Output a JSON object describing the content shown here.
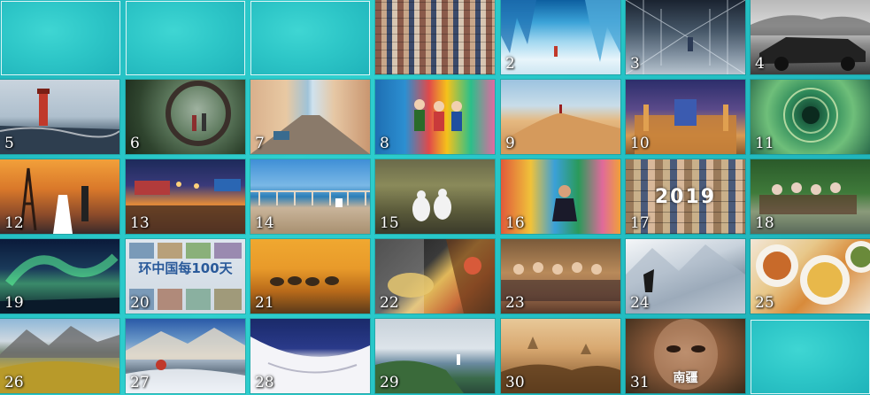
{
  "gallery": {
    "tiles": [
      {
        "number": "",
        "type": "blank"
      },
      {
        "number": "",
        "type": "blank"
      },
      {
        "number": "",
        "type": "blank"
      },
      {
        "number": "",
        "type": "photo",
        "subject": "photo mosaic collage"
      },
      {
        "number": "2",
        "type": "photo",
        "subject": "ice cave"
      },
      {
        "number": "3",
        "type": "photo",
        "subject": "glass corridor"
      },
      {
        "number": "4",
        "type": "photo",
        "subject": "vintage convertible"
      },
      {
        "number": "5",
        "type": "photo",
        "subject": "red lighthouse"
      },
      {
        "number": "6",
        "type": "photo",
        "subject": "moon gate garden"
      },
      {
        "number": "7",
        "type": "photo",
        "subject": "colonial street"
      },
      {
        "number": "8",
        "type": "photo",
        "subject": "colorful murals"
      },
      {
        "number": "9",
        "type": "photo",
        "subject": "desert dune"
      },
      {
        "number": "10",
        "type": "photo",
        "subject": "illuminated madrasa"
      },
      {
        "number": "11",
        "type": "photo",
        "subject": "spiral well"
      },
      {
        "number": "12",
        "type": "photo",
        "subject": "eiffel tower couple"
      },
      {
        "number": "13",
        "type": "photo",
        "subject": "night courtyard"
      },
      {
        "number": "14",
        "type": "photo",
        "subject": "seaside promenade"
      },
      {
        "number": "15",
        "type": "photo",
        "subject": "boobies birds"
      },
      {
        "number": "16",
        "type": "photo",
        "subject": "colorful street"
      },
      {
        "number": "17",
        "type": "photo",
        "subject": "2019 collage",
        "overlay": "2019"
      },
      {
        "number": "18",
        "type": "photo",
        "subject": "elderly group"
      },
      {
        "number": "19",
        "type": "photo",
        "subject": "aurora"
      },
      {
        "number": "20",
        "type": "photo",
        "subject": "travel poster",
        "overlay": "环中国每100天"
      },
      {
        "number": "21",
        "type": "photo",
        "subject": "elephants at sunset"
      },
      {
        "number": "22",
        "type": "photo",
        "subject": "food collage"
      },
      {
        "number": "23",
        "type": "photo",
        "subject": "group of friends"
      },
      {
        "number": "24",
        "type": "photo",
        "subject": "snowy mountain"
      },
      {
        "number": "25",
        "type": "photo",
        "subject": "dishes"
      },
      {
        "number": "26",
        "type": "photo",
        "subject": "alpine meadow"
      },
      {
        "number": "27",
        "type": "photo",
        "subject": "river and mountains"
      },
      {
        "number": "28",
        "type": "photo",
        "subject": "white architecture"
      },
      {
        "number": "29",
        "type": "photo",
        "subject": "coastal lighthouse"
      },
      {
        "number": "30",
        "type": "photo",
        "subject": "pagodas in haze"
      },
      {
        "number": "31",
        "type": "photo",
        "subject": "poster face",
        "overlay": "南疆"
      },
      {
        "number": "",
        "type": "blank"
      }
    ]
  }
}
